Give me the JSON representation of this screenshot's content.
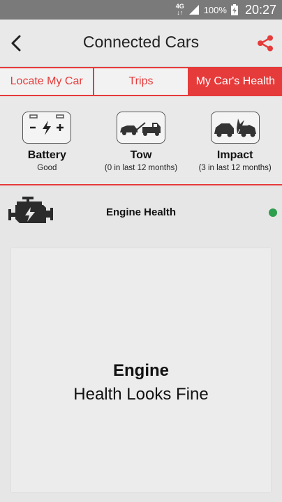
{
  "status_bar": {
    "network": "4G",
    "battery_pct": "100%",
    "time": "20:27"
  },
  "header": {
    "title": "Connected Cars",
    "back_icon": "chevron-left-icon",
    "share_icon": "share-icon",
    "share_color": "#e63b3b"
  },
  "tabs": [
    {
      "label": "Locate My Car",
      "active": false
    },
    {
      "label": "Trips",
      "active": false
    },
    {
      "label": "My Car's Health",
      "active": true
    }
  ],
  "health_items": [
    {
      "label": "Battery",
      "sub": "Good",
      "icon": "battery-icon"
    },
    {
      "label": "Tow",
      "sub": "(0 in last 12 months)",
      "icon": "tow-truck-icon"
    },
    {
      "label": "Impact",
      "sub": "(3 in last 12 months)",
      "icon": "car-crash-icon"
    }
  ],
  "engine": {
    "title": "Engine Health",
    "icon": "engine-icon",
    "status_color": "#2e9e4f",
    "card_title": "Engine",
    "card_message": "Health Looks Fine"
  },
  "colors": {
    "accent": "#e63b3b",
    "status_ok": "#2e9e4f"
  }
}
